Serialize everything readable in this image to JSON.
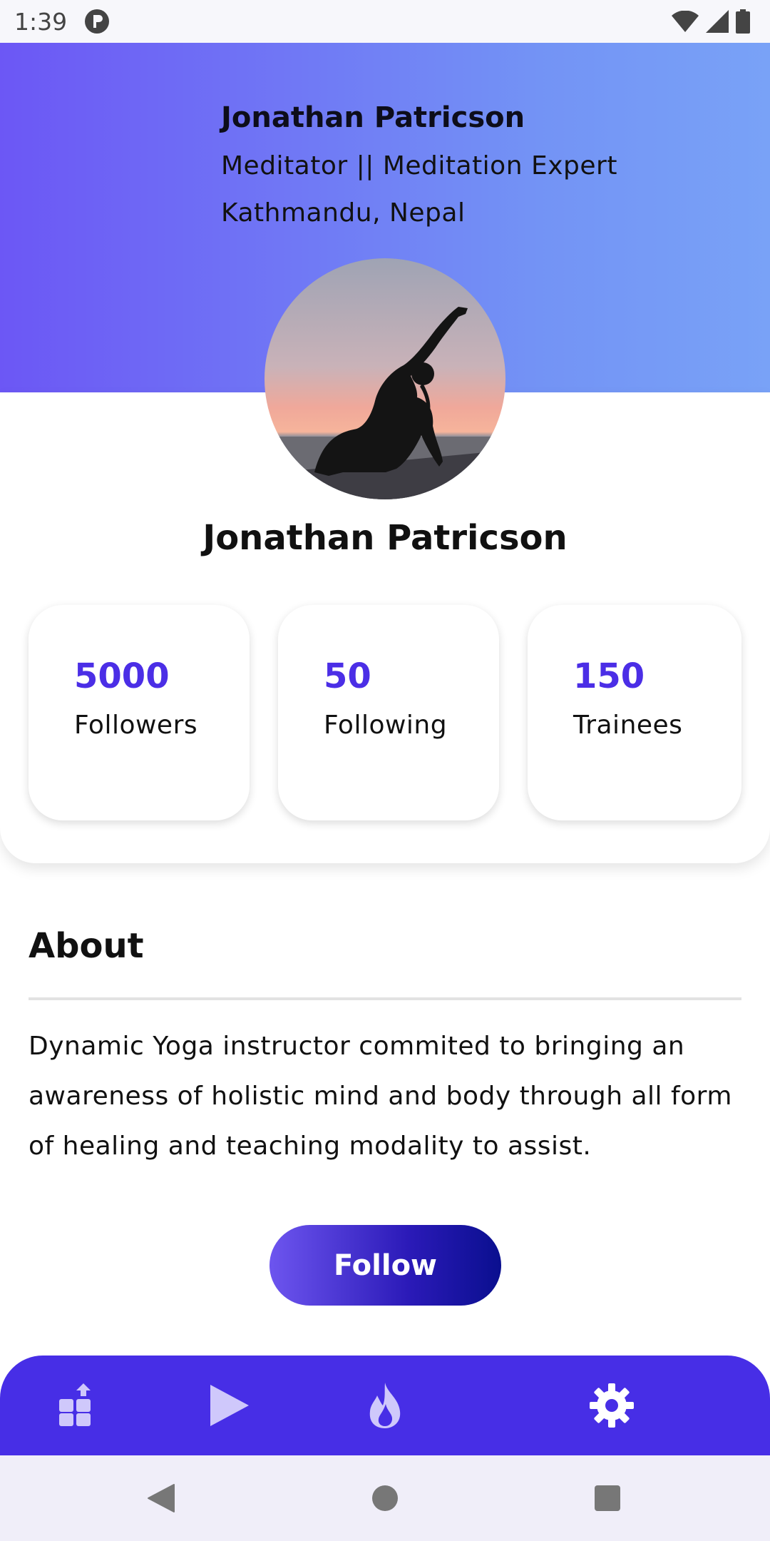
{
  "status_bar": {
    "time": "1:39"
  },
  "header": {
    "name": "Jonathan Patricson",
    "title": "Meditator || Meditation Expert",
    "location": "Kathmandu, Nepal"
  },
  "profile": {
    "name": "Jonathan Patricson",
    "stats": [
      {
        "value": "5000",
        "label": "Followers"
      },
      {
        "value": "50",
        "label": "Following"
      },
      {
        "value": "150",
        "label": "Trainees"
      }
    ]
  },
  "about": {
    "heading": "About",
    "text": "Dynamic Yoga instructor commited to bringing an awareness of holistic mind and body through all form of healing and teaching modality to assist."
  },
  "follow_label": "Follow",
  "bottom_nav": [
    {
      "icon": "share-grid-icon"
    },
    {
      "icon": "play-icon"
    },
    {
      "icon": "fire-icon"
    },
    {
      "icon": "gear-icon"
    }
  ],
  "colors": {
    "accent": "#472ee6",
    "stat_value": "#4b2ee6",
    "header_gradient_start": "#6c57f5",
    "header_gradient_end": "#79a2f7"
  }
}
